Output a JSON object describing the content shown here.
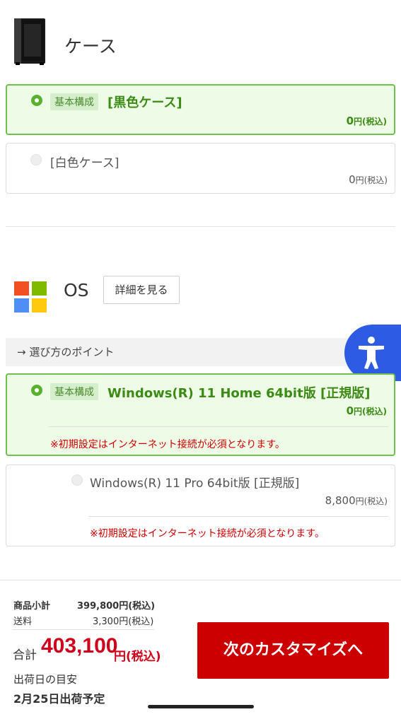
{
  "case_section": {
    "title": "ケース",
    "options": [
      {
        "badge": "基本構成",
        "name": "[黒色ケース]",
        "price": "0",
        "unit": "円(税込)",
        "selected": true
      },
      {
        "name": "[白色ケース]",
        "price": "0",
        "unit": "円(税込)",
        "selected": false
      }
    ]
  },
  "os_section": {
    "title": "OS",
    "detail_button": "詳細を見る",
    "point_label": "→ 選び方のポイント",
    "options": [
      {
        "badge": "基本構成",
        "name": "Windows(R) 11 Home 64bit版 [正規版]",
        "price": "0",
        "unit": "円(税込)",
        "note": "※初期設定はインターネット接続が必須となります。",
        "selected": true
      },
      {
        "name": "Windows(R) 11 Pro 64bit版 [正規版]",
        "price": "8,800",
        "unit": "円(税込)",
        "note": "※初期設定はインターネット接続が必須となります。",
        "selected": false
      }
    ]
  },
  "summary": {
    "subtotal_label": "商品小計",
    "subtotal_value": "399,800円(税込)",
    "shipping_label": "送料",
    "shipping_value": "3,300円(税込)",
    "total_label": "合計",
    "total_value": "403,100",
    "total_unit": "円(税込)",
    "ship_date_label": "出荷日の目安",
    "ship_date_value": "2月25日出荷予定",
    "next_button": "次のカスタマイズへ"
  },
  "icons": {
    "case": "pc-case-icon",
    "os": "windows-logo-icon",
    "accessibility": "accessibility-icon"
  },
  "colors": {
    "selected_border": "#6cc24a",
    "selected_bg": "#eefbe6",
    "selected_text": "#3b8b15",
    "price_red": "#d0021b",
    "next_button_bg": "#cc0000",
    "accessibility_bg": "#2d5be3"
  }
}
